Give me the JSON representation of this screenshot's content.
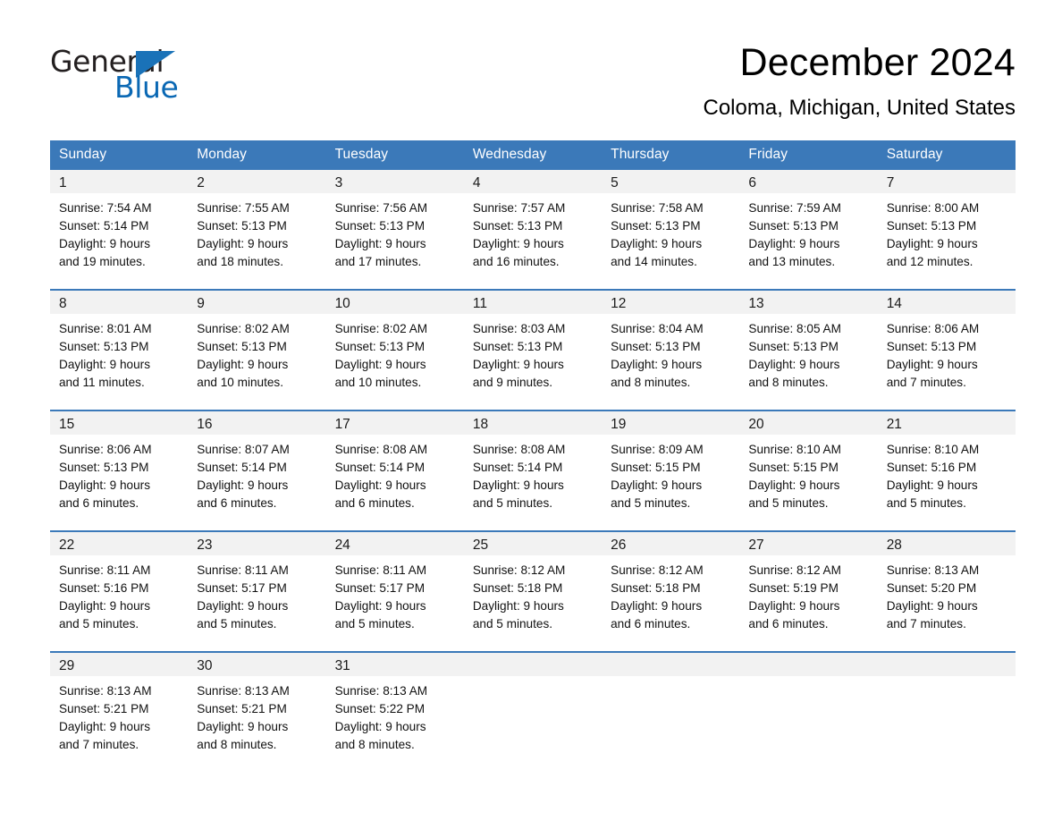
{
  "brand": {
    "name_part1": "General",
    "name_part2": "Blue",
    "triangle_color": "#1a72b8",
    "blue_color": "#0a68b4"
  },
  "header": {
    "month_title": "December 2024",
    "location": "Coloma, Michigan, United States"
  },
  "colors": {
    "header_blue": "#3b79b9",
    "daynum_bg": "#f2f2f2",
    "text": "#000000"
  },
  "calendar": {
    "weekday_headers": [
      "Sunday",
      "Monday",
      "Tuesday",
      "Wednesday",
      "Thursday",
      "Friday",
      "Saturday"
    ],
    "weeks": [
      [
        {
          "day": "1",
          "sunrise": "Sunrise: 7:54 AM",
          "sunset": "Sunset: 5:14 PM",
          "daylight_line1": "Daylight: 9 hours",
          "daylight_line2": "and 19 minutes."
        },
        {
          "day": "2",
          "sunrise": "Sunrise: 7:55 AM",
          "sunset": "Sunset: 5:13 PM",
          "daylight_line1": "Daylight: 9 hours",
          "daylight_line2": "and 18 minutes."
        },
        {
          "day": "3",
          "sunrise": "Sunrise: 7:56 AM",
          "sunset": "Sunset: 5:13 PM",
          "daylight_line1": "Daylight: 9 hours",
          "daylight_line2": "and 17 minutes."
        },
        {
          "day": "4",
          "sunrise": "Sunrise: 7:57 AM",
          "sunset": "Sunset: 5:13 PM",
          "daylight_line1": "Daylight: 9 hours",
          "daylight_line2": "and 16 minutes."
        },
        {
          "day": "5",
          "sunrise": "Sunrise: 7:58 AM",
          "sunset": "Sunset: 5:13 PM",
          "daylight_line1": "Daylight: 9 hours",
          "daylight_line2": "and 14 minutes."
        },
        {
          "day": "6",
          "sunrise": "Sunrise: 7:59 AM",
          "sunset": "Sunset: 5:13 PM",
          "daylight_line1": "Daylight: 9 hours",
          "daylight_line2": "and 13 minutes."
        },
        {
          "day": "7",
          "sunrise": "Sunrise: 8:00 AM",
          "sunset": "Sunset: 5:13 PM",
          "daylight_line1": "Daylight: 9 hours",
          "daylight_line2": "and 12 minutes."
        }
      ],
      [
        {
          "day": "8",
          "sunrise": "Sunrise: 8:01 AM",
          "sunset": "Sunset: 5:13 PM",
          "daylight_line1": "Daylight: 9 hours",
          "daylight_line2": "and 11 minutes."
        },
        {
          "day": "9",
          "sunrise": "Sunrise: 8:02 AM",
          "sunset": "Sunset: 5:13 PM",
          "daylight_line1": "Daylight: 9 hours",
          "daylight_line2": "and 10 minutes."
        },
        {
          "day": "10",
          "sunrise": "Sunrise: 8:02 AM",
          "sunset": "Sunset: 5:13 PM",
          "daylight_line1": "Daylight: 9 hours",
          "daylight_line2": "and 10 minutes."
        },
        {
          "day": "11",
          "sunrise": "Sunrise: 8:03 AM",
          "sunset": "Sunset: 5:13 PM",
          "daylight_line1": "Daylight: 9 hours",
          "daylight_line2": "and 9 minutes."
        },
        {
          "day": "12",
          "sunrise": "Sunrise: 8:04 AM",
          "sunset": "Sunset: 5:13 PM",
          "daylight_line1": "Daylight: 9 hours",
          "daylight_line2": "and 8 minutes."
        },
        {
          "day": "13",
          "sunrise": "Sunrise: 8:05 AM",
          "sunset": "Sunset: 5:13 PM",
          "daylight_line1": "Daylight: 9 hours",
          "daylight_line2": "and 8 minutes."
        },
        {
          "day": "14",
          "sunrise": "Sunrise: 8:06 AM",
          "sunset": "Sunset: 5:13 PM",
          "daylight_line1": "Daylight: 9 hours",
          "daylight_line2": "and 7 minutes."
        }
      ],
      [
        {
          "day": "15",
          "sunrise": "Sunrise: 8:06 AM",
          "sunset": "Sunset: 5:13 PM",
          "daylight_line1": "Daylight: 9 hours",
          "daylight_line2": "and 6 minutes."
        },
        {
          "day": "16",
          "sunrise": "Sunrise: 8:07 AM",
          "sunset": "Sunset: 5:14 PM",
          "daylight_line1": "Daylight: 9 hours",
          "daylight_line2": "and 6 minutes."
        },
        {
          "day": "17",
          "sunrise": "Sunrise: 8:08 AM",
          "sunset": "Sunset: 5:14 PM",
          "daylight_line1": "Daylight: 9 hours",
          "daylight_line2": "and 6 minutes."
        },
        {
          "day": "18",
          "sunrise": "Sunrise: 8:08 AM",
          "sunset": "Sunset: 5:14 PM",
          "daylight_line1": "Daylight: 9 hours",
          "daylight_line2": "and 5 minutes."
        },
        {
          "day": "19",
          "sunrise": "Sunrise: 8:09 AM",
          "sunset": "Sunset: 5:15 PM",
          "daylight_line1": "Daylight: 9 hours",
          "daylight_line2": "and 5 minutes."
        },
        {
          "day": "20",
          "sunrise": "Sunrise: 8:10 AM",
          "sunset": "Sunset: 5:15 PM",
          "daylight_line1": "Daylight: 9 hours",
          "daylight_line2": "and 5 minutes."
        },
        {
          "day": "21",
          "sunrise": "Sunrise: 8:10 AM",
          "sunset": "Sunset: 5:16 PM",
          "daylight_line1": "Daylight: 9 hours",
          "daylight_line2": "and 5 minutes."
        }
      ],
      [
        {
          "day": "22",
          "sunrise": "Sunrise: 8:11 AM",
          "sunset": "Sunset: 5:16 PM",
          "daylight_line1": "Daylight: 9 hours",
          "daylight_line2": "and 5 minutes."
        },
        {
          "day": "23",
          "sunrise": "Sunrise: 8:11 AM",
          "sunset": "Sunset: 5:17 PM",
          "daylight_line1": "Daylight: 9 hours",
          "daylight_line2": "and 5 minutes."
        },
        {
          "day": "24",
          "sunrise": "Sunrise: 8:11 AM",
          "sunset": "Sunset: 5:17 PM",
          "daylight_line1": "Daylight: 9 hours",
          "daylight_line2": "and 5 minutes."
        },
        {
          "day": "25",
          "sunrise": "Sunrise: 8:12 AM",
          "sunset": "Sunset: 5:18 PM",
          "daylight_line1": "Daylight: 9 hours",
          "daylight_line2": "and 5 minutes."
        },
        {
          "day": "26",
          "sunrise": "Sunrise: 8:12 AM",
          "sunset": "Sunset: 5:18 PM",
          "daylight_line1": "Daylight: 9 hours",
          "daylight_line2": "and 6 minutes."
        },
        {
          "day": "27",
          "sunrise": "Sunrise: 8:12 AM",
          "sunset": "Sunset: 5:19 PM",
          "daylight_line1": "Daylight: 9 hours",
          "daylight_line2": "and 6 minutes."
        },
        {
          "day": "28",
          "sunrise": "Sunrise: 8:13 AM",
          "sunset": "Sunset: 5:20 PM",
          "daylight_line1": "Daylight: 9 hours",
          "daylight_line2": "and 7 minutes."
        }
      ],
      [
        {
          "day": "29",
          "sunrise": "Sunrise: 8:13 AM",
          "sunset": "Sunset: 5:21 PM",
          "daylight_line1": "Daylight: 9 hours",
          "daylight_line2": "and 7 minutes."
        },
        {
          "day": "30",
          "sunrise": "Sunrise: 8:13 AM",
          "sunset": "Sunset: 5:21 PM",
          "daylight_line1": "Daylight: 9 hours",
          "daylight_line2": "and 8 minutes."
        },
        {
          "day": "31",
          "sunrise": "Sunrise: 8:13 AM",
          "sunset": "Sunset: 5:22 PM",
          "daylight_line1": "Daylight: 9 hours",
          "daylight_line2": "and 8 minutes."
        },
        {
          "day": "",
          "sunrise": "",
          "sunset": "",
          "daylight_line1": "",
          "daylight_line2": ""
        },
        {
          "day": "",
          "sunrise": "",
          "sunset": "",
          "daylight_line1": "",
          "daylight_line2": ""
        },
        {
          "day": "",
          "sunrise": "",
          "sunset": "",
          "daylight_line1": "",
          "daylight_line2": ""
        },
        {
          "day": "",
          "sunrise": "",
          "sunset": "",
          "daylight_line1": "",
          "daylight_line2": ""
        }
      ]
    ]
  }
}
